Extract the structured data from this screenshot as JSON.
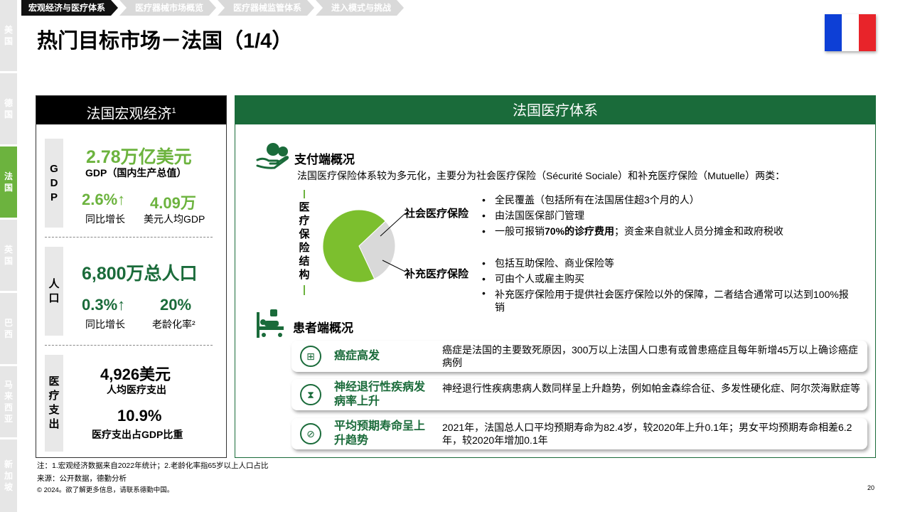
{
  "side_tabs": [
    {
      "label": "美国",
      "active": false
    },
    {
      "label": "德国",
      "active": false
    },
    {
      "label": "法国",
      "active": true
    },
    {
      "label": "英国",
      "active": false
    },
    {
      "label": "巴西",
      "active": false
    },
    {
      "label": "马来西亚",
      "active": false
    },
    {
      "label": "新加坡",
      "active": false
    }
  ],
  "breadcrumbs": [
    "宏观经济与医疗体系",
    "医疗器械市场概览",
    "医疗器械监管体系",
    "进入模式与挑战"
  ],
  "title": "热门目标市场－法国（1/4）",
  "flag_colors": [
    "#0d3fd6",
    "#ffffff",
    "#e8242a"
  ],
  "left_panel": {
    "header": "法国宏观经济",
    "header_sup": "1",
    "gdp": {
      "label": "GDP",
      "value": "2.78万亿美元",
      "value_desc": "GDP（国内生产总值）",
      "growth": "2.6%",
      "growth_label": "同比增长",
      "per_capita": "4.09万",
      "per_capita_label": "美元人均GDP"
    },
    "population": {
      "label": "人口",
      "value": "6,800万总人口",
      "growth": "0.3%",
      "growth_label": "同比增长",
      "aging": "20%",
      "aging_label": "老龄化率²"
    },
    "health_spend": {
      "label": "医疗支出",
      "value": "4,926美元",
      "value_desc": "人均医疗支出",
      "ratio": "10.9%",
      "ratio_desc": "医疗支出占GDP比重"
    }
  },
  "right_panel": {
    "header": "法国医疗体系",
    "payer": {
      "title": "支付端概况",
      "desc": "法国医疗保险体系较为多元化，主要分为社会医疗保险（Sécurité Sociale）和补充医疗保险（Mutuelle）两类：",
      "vertical_label": "医疗保险结构",
      "social_label": "社会医疗保险",
      "supp_label": "补充医疗保险",
      "social_bullets": [
        "全民覆盖（包括所有在法国居住超3个月的人）",
        "由法国医保部门管理"
      ],
      "social_bullet3_pre": "一般可报销",
      "social_bullet3_bold": "70%的诊疗费用",
      "social_bullet3_post": "；资金来自就业人员分摊金和政府税收",
      "supp_bullets": [
        "包括互助保险、商业保险等",
        "可由个人或雇主购买",
        "补充医疗保险用于提供社会医疗保险以外的保障，二者结合通常可以达到100%报销"
      ]
    },
    "pie_data": {
      "type": "pie",
      "slices": [
        {
          "label": "社会医疗保险",
          "color": "#7cbf2e",
          "fraction": 0.7
        },
        {
          "label": "补充医疗保险",
          "color": "#d9d9d9",
          "fraction": 0.3
        }
      ]
    },
    "patient": {
      "title": "患者端概况",
      "cards": [
        {
          "icon": "medical-box-icon",
          "title": "癌症高发",
          "text": "癌症是法国的主要致死原因，300万以上法国人口患有或曾患癌症且每年新增45万以上确诊癌症病例"
        },
        {
          "icon": "dna-icon",
          "title": "神经退行性疾病发病率上升",
          "text": "神经退行性疾病患病人数同样呈上升趋势，例如帕金森综合征、多发性硬化症、阿尔茨海默症等"
        },
        {
          "icon": "pills-icon",
          "title": "平均预期寿命呈上升趋势",
          "text": "2021年，法国总人口平均预期寿命为82.4岁，较2020年上升0.1年；男女平均预期寿命相差6.2年，较2020年增加0.1年"
        }
      ]
    }
  },
  "notes": {
    "note": "注：1.宏观经济数据来自2022年统计；2.老龄化率指65岁以上人口占比",
    "source": "来源：公开数据，德勤分析",
    "copyright": "© 2024。欲了解更多信息，请联系德勤中国。",
    "page": "20"
  }
}
